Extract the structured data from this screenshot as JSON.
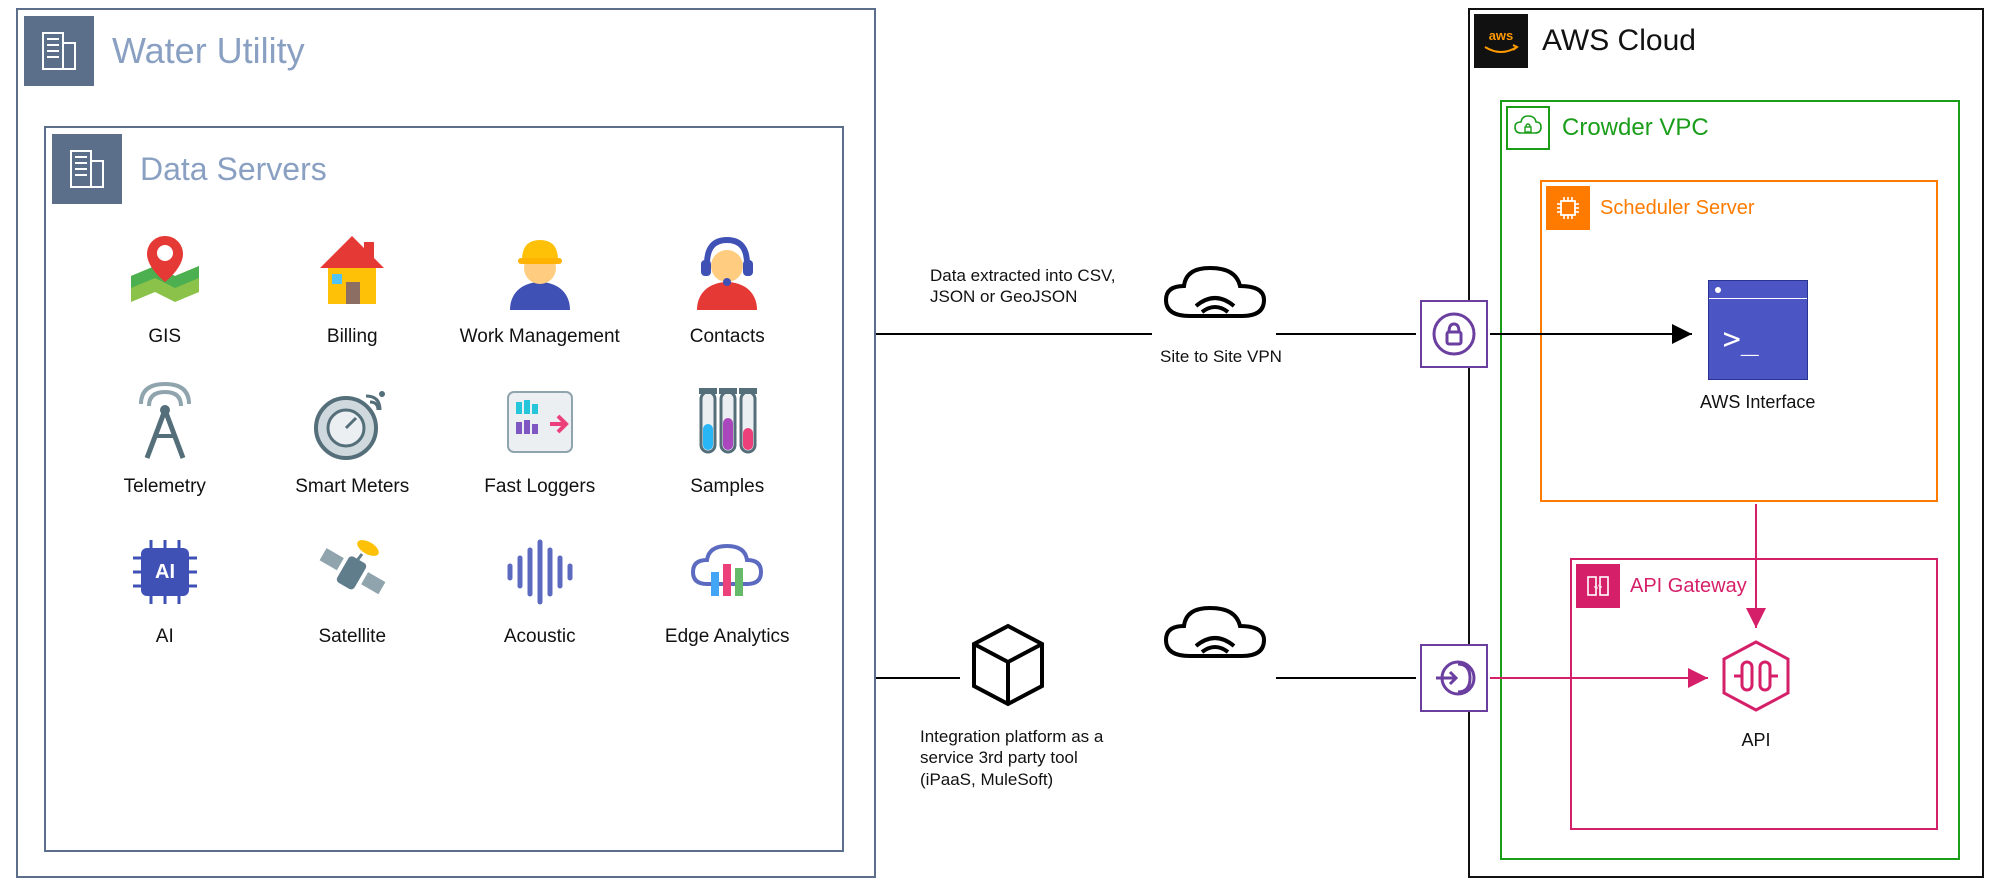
{
  "waterUtility": {
    "title": "Water Utility",
    "dataServers": {
      "title": "Data Servers",
      "items": [
        {
          "label": "GIS"
        },
        {
          "label": "Billing"
        },
        {
          "label": "Work Management"
        },
        {
          "label": "Contacts"
        },
        {
          "label": "Telemetry"
        },
        {
          "label": "Smart Meters"
        },
        {
          "label": "Fast Loggers"
        },
        {
          "label": "Samples"
        },
        {
          "label": "AI"
        },
        {
          "label": "Satellite"
        },
        {
          "label": "Acoustic"
        },
        {
          "label": "Edge Analytics"
        }
      ]
    }
  },
  "middle": {
    "extract_label": "Data extracted into CSV, JSON or GeoJSON",
    "vpn_label": "Site to Site VPN",
    "ipaas_label": "Integration platform as a service 3rd party tool (iPaaS, MuleSoft)"
  },
  "awsCloud": {
    "title": "AWS Cloud",
    "logo_text": "aws",
    "vpc": {
      "title": "Crowder VPC",
      "scheduler": {
        "title": "Scheduler Server",
        "interface_label": "AWS Interface"
      },
      "apiGateway": {
        "title": "API Gateway",
        "api_label": "API"
      }
    }
  },
  "colors": {
    "water_border": "#5c6f8a",
    "vpc_green": "#1a9e1a",
    "sched_orange": "#ff7b00",
    "api_pink": "#d61f69",
    "aws_purple": "#6b3fa0",
    "aws_blue": "#4b55c4"
  }
}
